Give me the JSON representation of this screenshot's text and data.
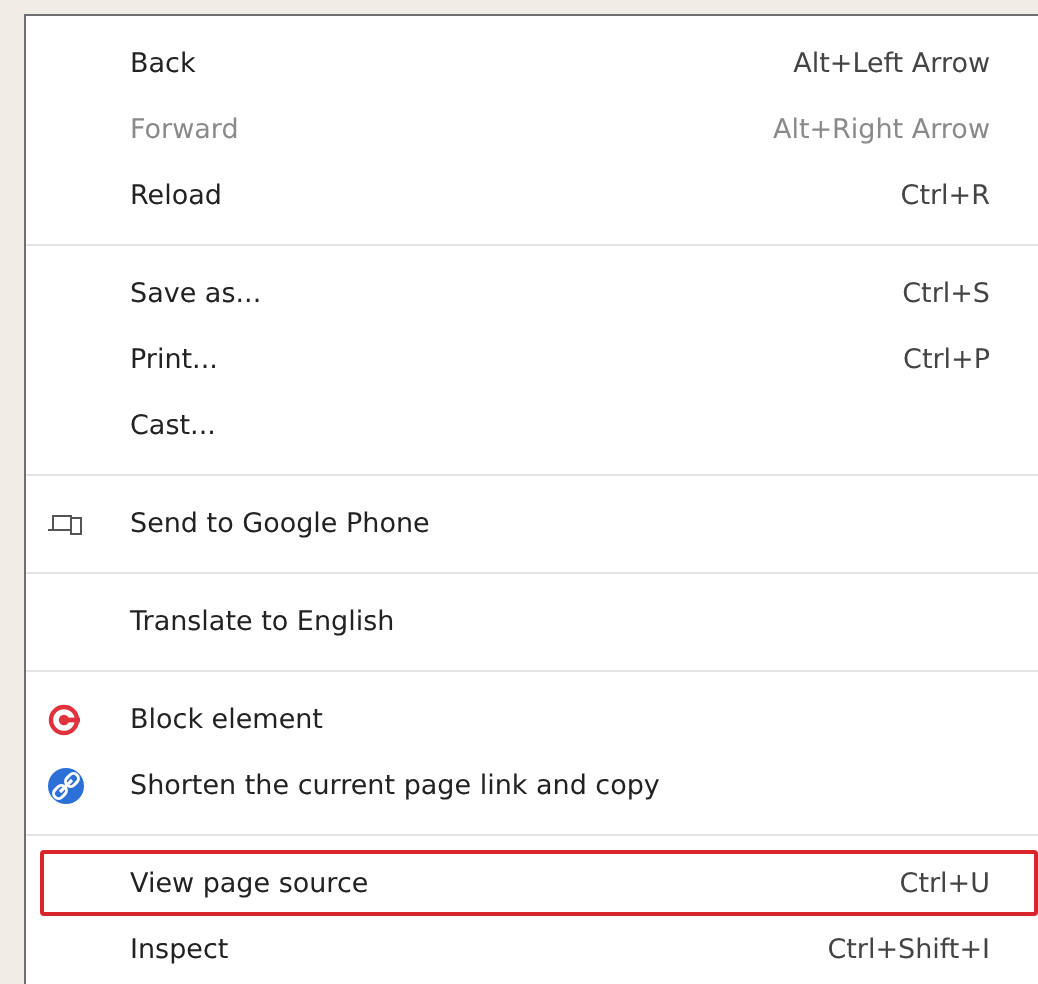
{
  "menu": {
    "groups": [
      {
        "items": [
          {
            "label": "Back",
            "shortcut": "Alt+Left Arrow",
            "disabled": false,
            "outlined": false
          },
          {
            "label": "Forward",
            "shortcut": "Alt+Right Arrow",
            "disabled": true,
            "outlined": false
          },
          {
            "label": "Reload",
            "shortcut": "Ctrl+R",
            "disabled": false,
            "outlined": false
          }
        ]
      },
      {
        "items": [
          {
            "label": "Save as...",
            "shortcut": "Ctrl+S",
            "disabled": false,
            "outlined": false
          },
          {
            "label": "Print...",
            "shortcut": "Ctrl+P",
            "disabled": false,
            "outlined": false
          },
          {
            "label": "Cast...",
            "disabled": false,
            "outlined": false
          }
        ]
      },
      {
        "items": [
          {
            "label": "Send to Google Phone",
            "kind": "devices",
            "disabled": false,
            "outlined": false
          }
        ]
      },
      {
        "items": [
          {
            "label": "Translate to English",
            "disabled": false,
            "outlined": false
          }
        ]
      },
      {
        "items": [
          {
            "label": "Block element",
            "kind": "target",
            "disabled": false,
            "outlined": false
          },
          {
            "label": "Shorten the current page link and copy",
            "kind": "link",
            "disabled": false,
            "outlined": false
          }
        ]
      },
      {
        "items": [
          {
            "label": "View page source",
            "shortcut": "Ctrl+U",
            "disabled": false,
            "outlined": true
          },
          {
            "label": "Inspect",
            "shortcut": "Ctrl+Shift+I",
            "disabled": false,
            "outlined": false
          }
        ]
      }
    ]
  }
}
